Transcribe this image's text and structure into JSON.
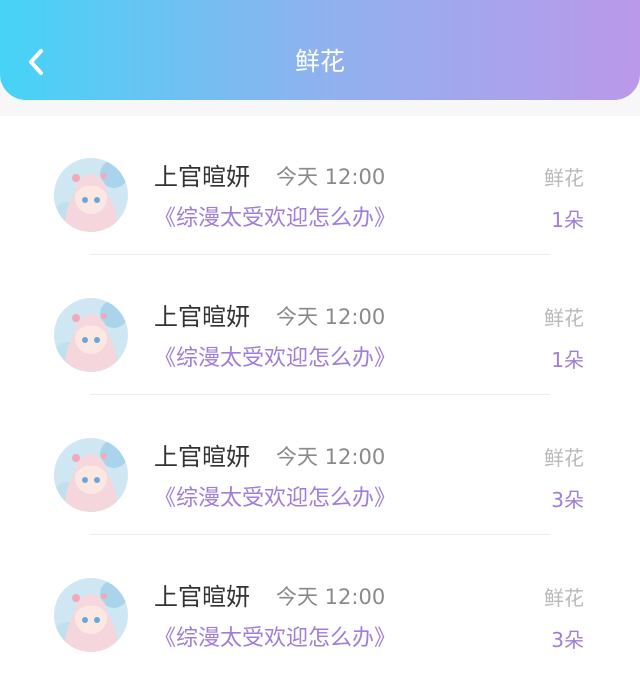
{
  "header": {
    "title": "鲜花",
    "back_icon": "chevron-left-icon"
  },
  "items": [
    {
      "name": "上官暄妍",
      "time": "今天 12:00",
      "book": "《综漫太受欢迎怎么办》",
      "gift_type": "鲜花",
      "count": "1朵"
    },
    {
      "name": "上官暄妍",
      "time": "今天 12:00",
      "book": "《综漫太受欢迎怎么办》",
      "gift_type": "鲜花",
      "count": "1朵"
    },
    {
      "name": "上官暄妍",
      "time": "今天 12:00",
      "book": "《综漫太受欢迎怎么办》",
      "gift_type": "鲜花",
      "count": "3朵"
    },
    {
      "name": "上官暄妍",
      "time": "今天 12:00",
      "book": "《综漫太受欢迎怎么办》",
      "gift_type": "鲜花",
      "count": "3朵"
    }
  ],
  "colors": {
    "header_gradient_start": "#45d3f6",
    "header_gradient_end": "#bb98ea",
    "accent_purple": "#a07ed8"
  }
}
